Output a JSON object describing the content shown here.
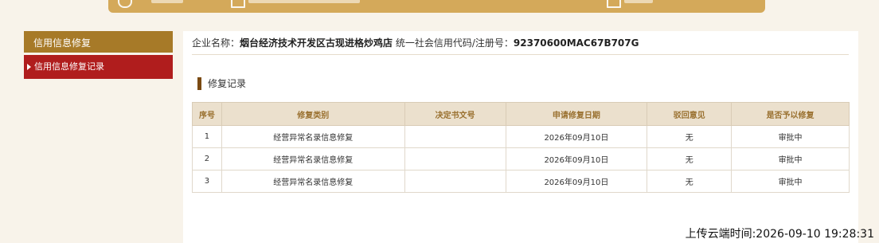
{
  "sidebar": {
    "heading": "信用信息修复",
    "items": [
      {
        "label": "信用信息修复记录"
      }
    ]
  },
  "company": {
    "name_label": "企业名称：",
    "name": "烟台经济技术开发区古现进格炒鸡店",
    "code_label": "统一社会信用代码/注册号：",
    "code": "92370600MAC67B707G"
  },
  "section": {
    "title": "修复记录"
  },
  "table": {
    "headers": [
      "序号",
      "修复类别",
      "决定书文号",
      "申请修复日期",
      "驳回意见",
      "是否予以修复"
    ],
    "rows": [
      [
        "1",
        "经营异常名录信息修复",
        "",
        "2026年09月10日",
        "无",
        "审批中"
      ],
      [
        "2",
        "经营异常名录信息修复",
        "",
        "2026年09月10日",
        "无",
        "审批中"
      ],
      [
        "3",
        "经营异常名录信息修复",
        "",
        "2026年09月10日",
        "无",
        "审批中"
      ]
    ]
  },
  "footer": {
    "upload_time": "上传云端时间:2026-09-10 19:28:31"
  }
}
